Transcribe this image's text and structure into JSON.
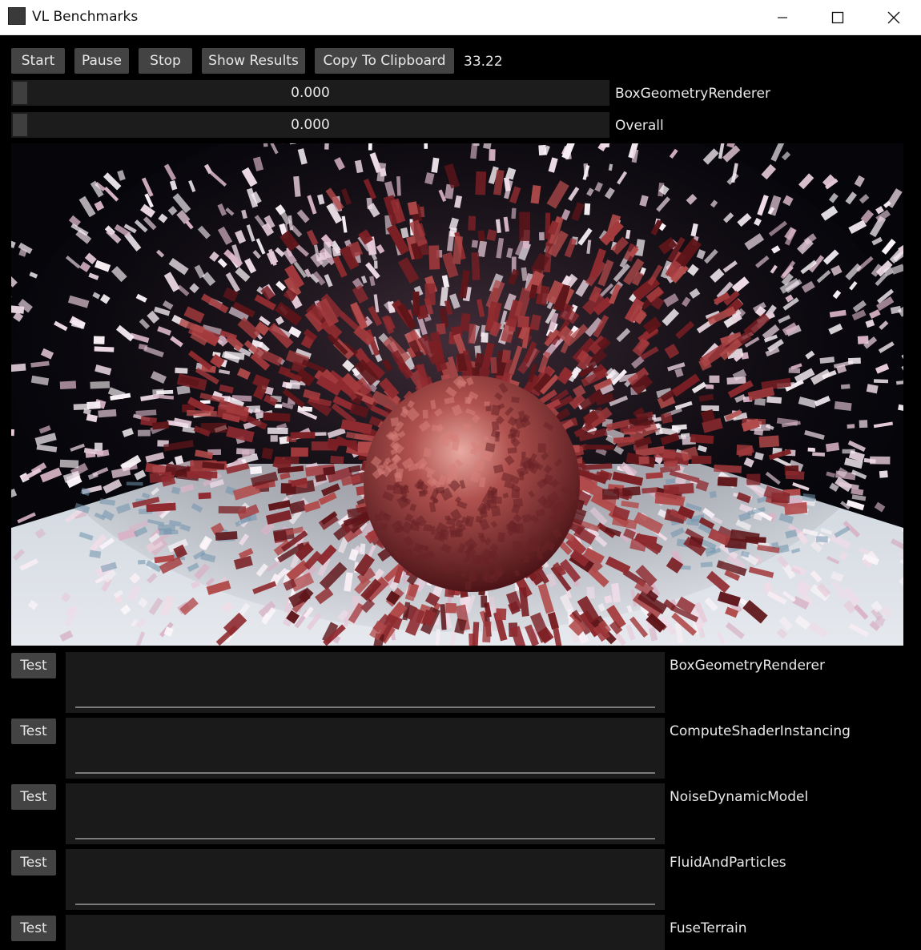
{
  "window": {
    "title": "VL Benchmarks",
    "controls": [
      "minimize-icon",
      "maximize-icon",
      "close-icon"
    ]
  },
  "toolbar": {
    "start_label": "Start",
    "pause_label": "Pause",
    "stop_label": "Stop",
    "show_results_label": "Show Results",
    "copy_label": "Copy To Clipboard",
    "fps": "33.22"
  },
  "progress": [
    {
      "value": "0.000",
      "label": "BoxGeometryRenderer"
    },
    {
      "value": "0.000",
      "label": "Overall"
    }
  ],
  "tests": [
    {
      "button": "Test",
      "name": "BoxGeometryRenderer"
    },
    {
      "button": "Test",
      "name": "ComputeShaderInstancing"
    },
    {
      "button": "Test",
      "name": "NoiseDynamicModel"
    },
    {
      "button": "Test",
      "name": "FluidAndParticles"
    },
    {
      "button": "Test",
      "name": "FuseTerrain"
    }
  ],
  "colors": {
    "background": "#000000",
    "button": "#434343",
    "field": "#1a1a1a",
    "text": "#e8e8e8",
    "box_red": "#8a2a2e",
    "box_white": "#f4e6ef",
    "floor": "#dfe3e8"
  }
}
